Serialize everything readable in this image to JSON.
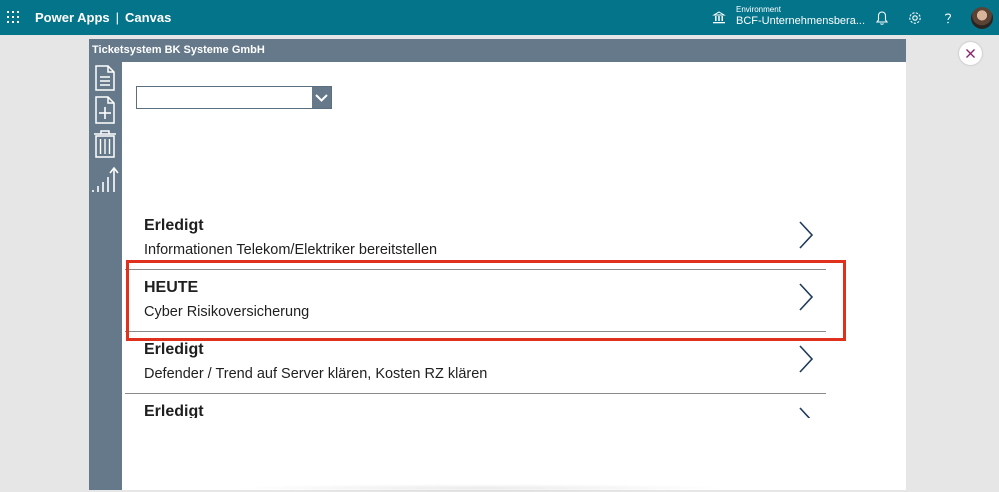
{
  "topbar": {
    "product": "Power Apps",
    "separator": "|",
    "mode": "Canvas",
    "environment_label": "Environment",
    "environment_value": "BCF-Unternehmensbera...",
    "icons": [
      "app-launcher-icon",
      "environment-icon",
      "bell-icon",
      "gear-icon",
      "help-icon",
      "avatar"
    ]
  },
  "app": {
    "title": "Ticketsystem BK Systeme GmbH",
    "sidebar_icons": [
      "document-icon",
      "add-document-icon",
      "trash-icon",
      "chart-icon"
    ],
    "dropdown": {
      "value": ""
    },
    "items": [
      {
        "status": "Erledigt",
        "title": "Informationen Telekom/Elektriker bereitstellen"
      },
      {
        "status": "HEUTE",
        "title": "Cyber Risikoversicherung"
      },
      {
        "status": "Erledigt",
        "title": "Defender / Trend auf Server klären, Kosten RZ klären"
      },
      {
        "status": "Erledigt",
        "title": ""
      }
    ]
  },
  "colors": {
    "topbar": "#04748b",
    "app_header": "#65798a",
    "highlight": "#e0301e"
  }
}
